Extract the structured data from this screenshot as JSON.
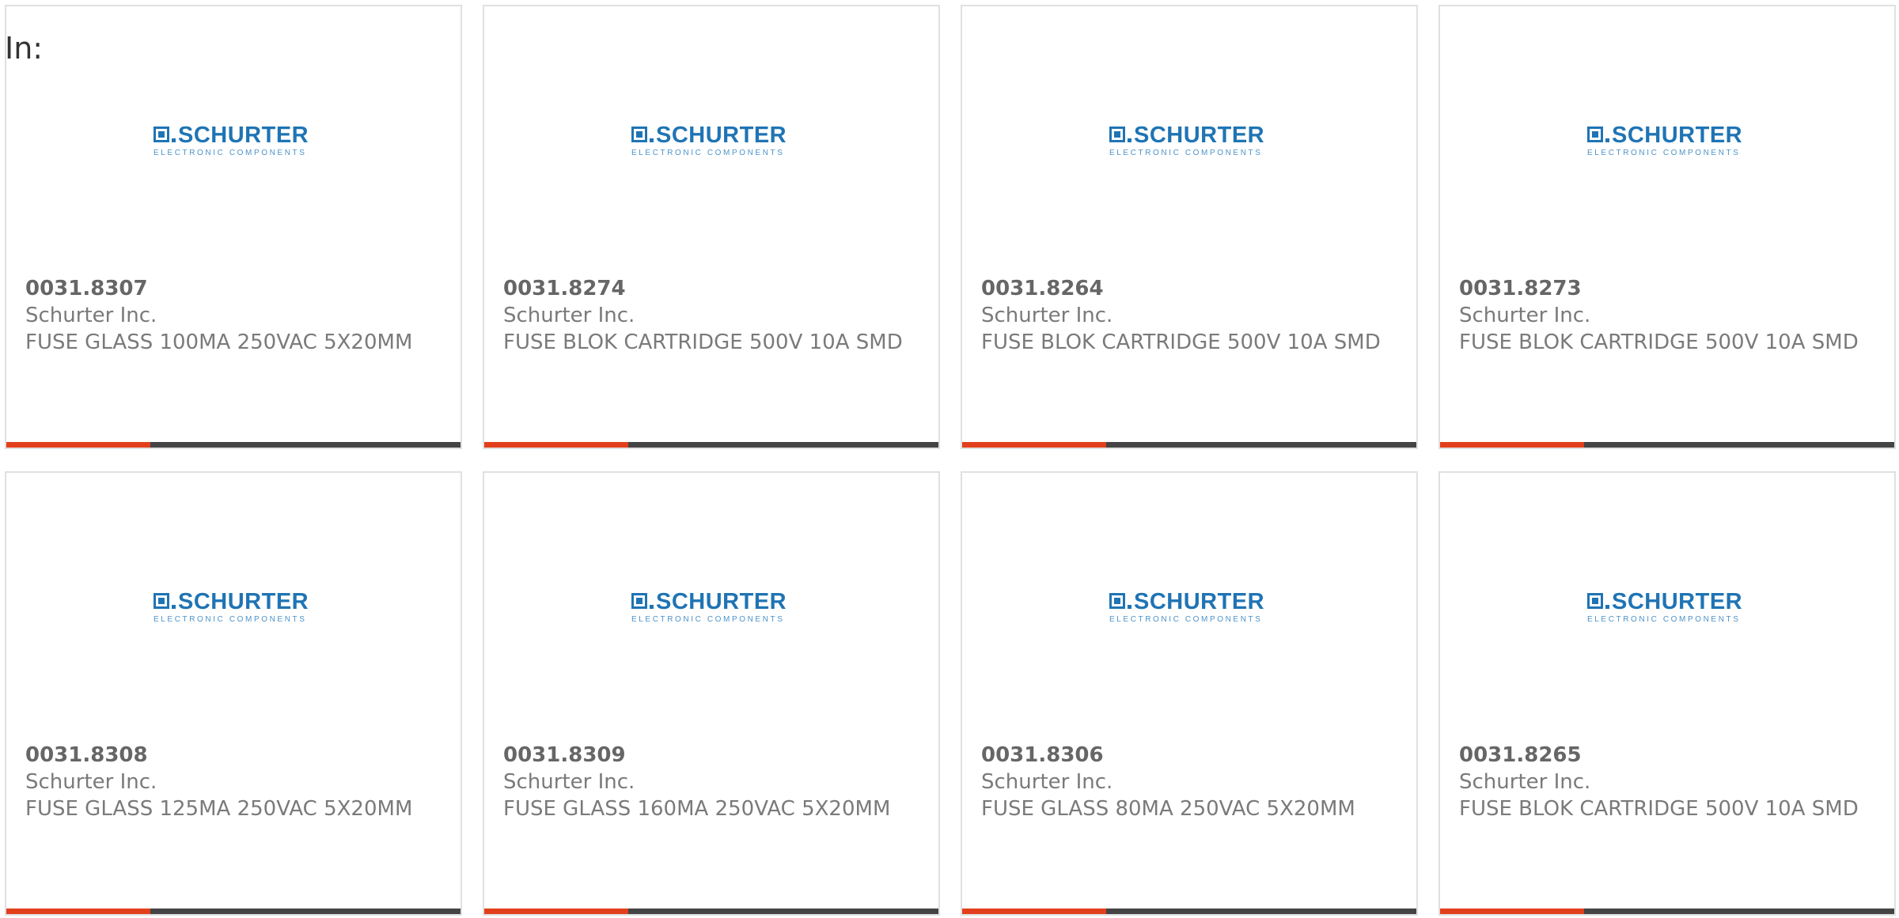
{
  "page": {
    "filter_label": "In:"
  },
  "colors": {
    "brand_blue": "#1f74b4",
    "accent_orange": "#e2401c",
    "bar_dark": "#444444"
  },
  "logo": {
    "word": "SCHURTER",
    "subtitle": "ELECTRONIC COMPONENTS"
  },
  "products": [
    {
      "part_number": "0031.8307",
      "manufacturer": "Schurter Inc.",
      "description": "FUSE GLASS 100MA 250VAC 5X20MM"
    },
    {
      "part_number": "0031.8274",
      "manufacturer": "Schurter Inc.",
      "description": "FUSE BLOK CARTRIDGE 500V 10A SMD"
    },
    {
      "part_number": "0031.8264",
      "manufacturer": "Schurter Inc.",
      "description": "FUSE BLOK CARTRIDGE 500V 10A SMD"
    },
    {
      "part_number": "0031.8273",
      "manufacturer": "Schurter Inc.",
      "description": "FUSE BLOK CARTRIDGE 500V 10A SMD"
    },
    {
      "part_number": "0031.8308",
      "manufacturer": "Schurter Inc.",
      "description": "FUSE GLASS 125MA 250VAC 5X20MM"
    },
    {
      "part_number": "0031.8309",
      "manufacturer": "Schurter Inc.",
      "description": "FUSE GLASS 160MA 250VAC 5X20MM"
    },
    {
      "part_number": "0031.8306",
      "manufacturer": "Schurter Inc.",
      "description": "FUSE GLASS 80MA 250VAC 5X20MM"
    },
    {
      "part_number": "0031.8265",
      "manufacturer": "Schurter Inc.",
      "description": "FUSE BLOK CARTRIDGE 500V 10A SMD"
    }
  ]
}
